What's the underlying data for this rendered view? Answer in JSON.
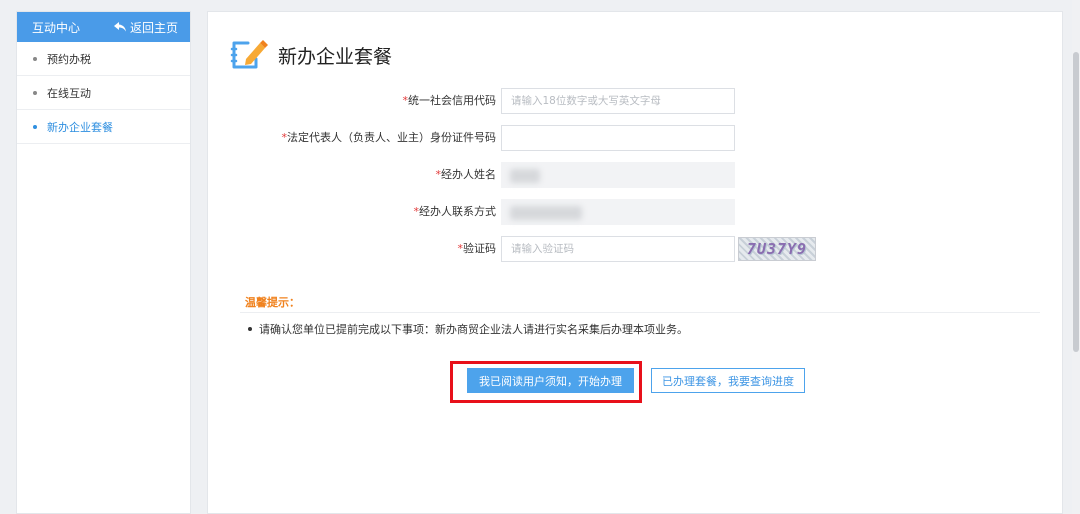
{
  "sidebar": {
    "header_title": "互动中心",
    "back_label": "返回主页",
    "items": [
      {
        "label": "预约办税"
      },
      {
        "label": "在线互动"
      },
      {
        "label": "新办企业套餐"
      }
    ]
  },
  "main": {
    "title": "新办企业套餐",
    "form": {
      "credit_code": {
        "label": "统一社会信用代码",
        "required_mark": "*",
        "placeholder": "请输入18位数字或大写英文字母",
        "value": ""
      },
      "legal_id": {
        "label": "法定代表人（负责人、业主）身份证件号码",
        "required_mark": "*",
        "value": ""
      },
      "agent_name": {
        "label": "经办人姓名",
        "required_mark": "*"
      },
      "agent_contact": {
        "label": "经办人联系方式",
        "required_mark": "*"
      },
      "captcha": {
        "label": "验证码",
        "required_mark": "*",
        "placeholder": "请输入验证码",
        "value": "",
        "image_text": "7U37Y9"
      }
    },
    "tips": {
      "title": "温馨提示：",
      "items": [
        "请确认您单位已提前完成以下事项：新办商贸企业法人请进行实名采集后办理本项业务。"
      ]
    },
    "buttons": {
      "start": "我已阅读用户须知，开始办理",
      "query": "已办理套餐，我要查询进度"
    }
  },
  "colors": {
    "accent": "#4a9be8",
    "tip_title": "#f0821e",
    "required": "#e23a3a",
    "highlight": "#e8101a"
  }
}
